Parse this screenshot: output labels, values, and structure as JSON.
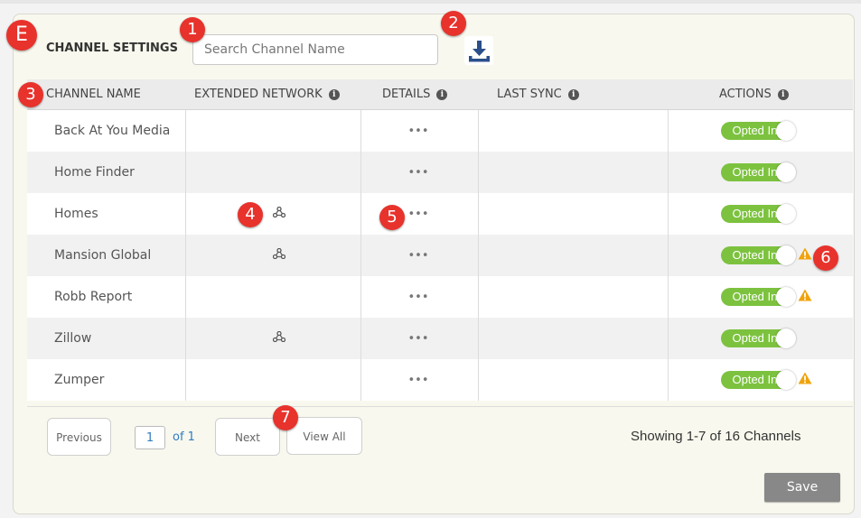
{
  "header": {
    "title": "CHANNEL SETTINGS",
    "search_placeholder": "Search Channel Name",
    "download_icon": "download-icon"
  },
  "table": {
    "columns": [
      "CHANNEL NAME",
      "EXTENDED NETWORK",
      "DETAILS",
      "LAST SYNC",
      "ACTIONS"
    ],
    "rows": [
      {
        "name": "Back At You Media",
        "extended": false,
        "details": "•••",
        "last_sync": "",
        "action": "Opted In",
        "warning": false
      },
      {
        "name": "Home Finder",
        "extended": false,
        "details": "•••",
        "last_sync": "",
        "action": "Opted In",
        "warning": false
      },
      {
        "name": "Homes",
        "extended": true,
        "details": "•••",
        "last_sync": "",
        "action": "Opted In",
        "warning": false
      },
      {
        "name": "Mansion Global",
        "extended": true,
        "details": "•••",
        "last_sync": "",
        "action": "Opted In",
        "warning": true
      },
      {
        "name": "Robb Report",
        "extended": false,
        "details": "•••",
        "last_sync": "",
        "action": "Opted In",
        "warning": true
      },
      {
        "name": "Zillow",
        "extended": true,
        "details": "•••",
        "last_sync": "",
        "action": "Opted In",
        "warning": false
      },
      {
        "name": "Zumper",
        "extended": false,
        "details": "•••",
        "last_sync": "",
        "action": "Opted In",
        "warning": true
      }
    ]
  },
  "pagination": {
    "previous": "Previous",
    "page": "1",
    "of": "of 1",
    "next": "Next",
    "view_all": "View All",
    "showing": "Showing 1-7 of 16 Channels"
  },
  "save_label": "Save",
  "callouts": [
    "E",
    "1",
    "2",
    "3",
    "4",
    "5",
    "6",
    "7"
  ],
  "colors": {
    "toggle_on": "#7cc23f",
    "badge": "#e8322c",
    "warning": "#f0a30a",
    "link": "#2f7cc3",
    "download_icon": "#2a4f8a"
  }
}
